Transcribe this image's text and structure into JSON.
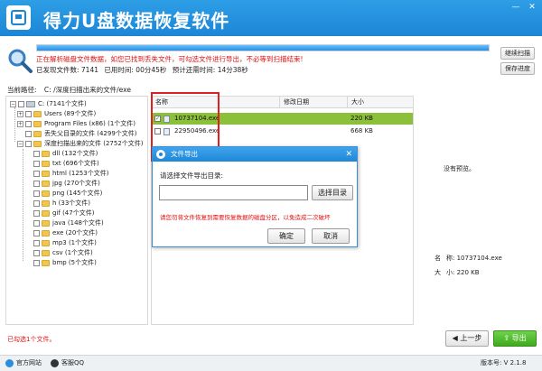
{
  "window": {
    "title": "得力U盘数据恢复软件",
    "minimize_icon": "minimize-icon",
    "close_icon": "close-icon"
  },
  "scan": {
    "progress": 1.0,
    "warning": "正在解析磁盘文件数据，如您已找到丢失文件，可勾选文件进行导出，不必等到扫描结束!",
    "found_label": "已发现文件数: 7141",
    "elapsed_label": "已用时间: 00分45秒",
    "remaining_label": "预计还需时间: 14分38秒",
    "continue_button": "继续扫描",
    "save_progress_button": "保存进度"
  },
  "current_path": {
    "label": "当前路径:",
    "value": "C: /深度扫描出来的文件/exe"
  },
  "tree": {
    "root": "C:  (7141个文件)",
    "users": "Users  (89个文件)",
    "program_files": "Program Files (x86)  (1个文件)",
    "lost_parent": "丢失父目录的文件  (4299个文件)",
    "deep_scan": "深度扫描出来的文件  (2752个文件)",
    "children": [
      "dll  (132个文件)",
      "txt  (696个文件)",
      "html  (1253个文件)",
      "jpg  (270个文件)",
      "png  (145个文件)",
      "h  (33个文件)",
      "gif  (47个文件)",
      "java  (148个文件)",
      "exe  (20个文件)",
      "mp3  (1个文件)",
      "csv  (1个文件)",
      "bmp  (5个文件)"
    ]
  },
  "list": {
    "headers": [
      "名称",
      "修改日期",
      "大小"
    ],
    "rows": [
      {
        "name": "10737104.exe",
        "date": "",
        "size": "220 KB",
        "checked": true
      },
      {
        "name": "22950496.exe",
        "date": "",
        "size": "668 KB",
        "checked": false
      }
    ]
  },
  "preview": {
    "no_preview": "没有预览。",
    "name_label": "名",
    "name_value": "称: 10737104.exe",
    "size_label": "大",
    "size_value": "小: 220 KB"
  },
  "dialog": {
    "title": "文件导出",
    "prompt": "请选择文件导出目录:",
    "input_value": "",
    "browse_button": "选择目录",
    "warning": "请您勿将文件恢复到需要恢复数据的磁盘分区，以免造成二次破坏",
    "ok_button": "确定",
    "cancel_button": "取消"
  },
  "footer": {
    "selected_count": "已勾选1个文件。",
    "prev_button": "上一步",
    "export_button": "导出"
  },
  "statusbar": {
    "website": "官方网站",
    "qq": "客服QQ",
    "version": "版本号: V 2.1.8"
  },
  "colors": {
    "title_bar": "#1b86d6",
    "selected_row": "#8ac03a",
    "warning_text": "#e01010",
    "export_button": "#3ea91e"
  }
}
